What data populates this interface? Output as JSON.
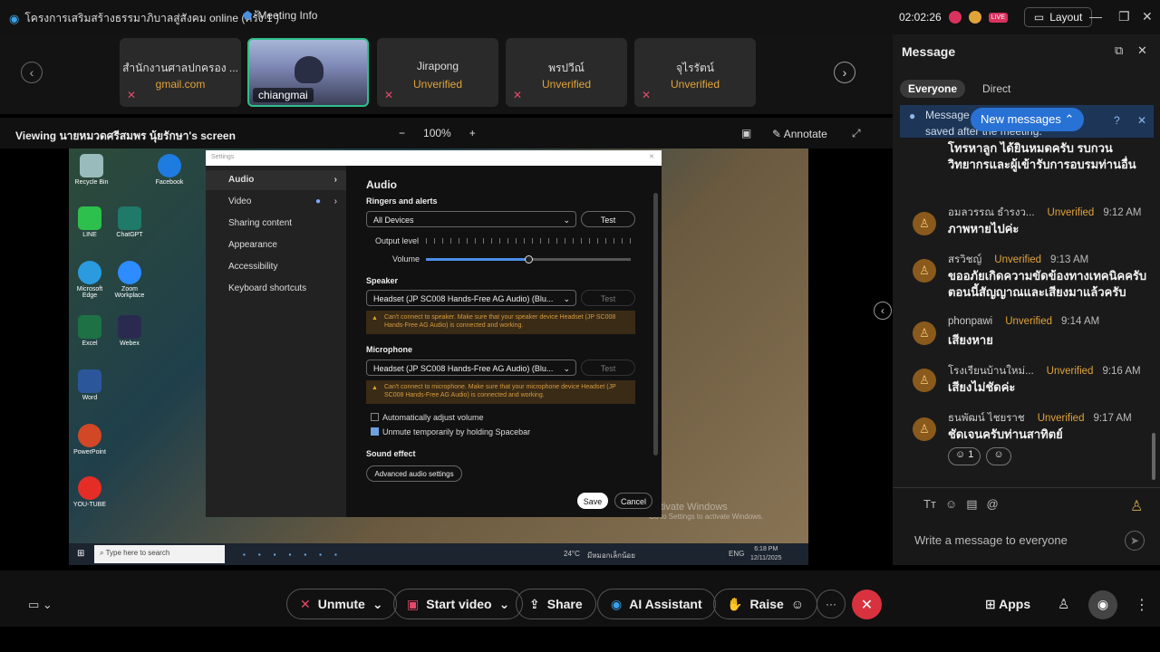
{
  "topbar": {
    "title": "โครงการเสริมสร้างธรรมาภิบาลสู่สังคม online (ครั้ง 1 )",
    "meeting_info": "Meeting Info",
    "timer": "02:02:26",
    "layout_label": "Layout",
    "badge_live": "LIVE"
  },
  "thumbnails": [
    {
      "name": "สำนักงานศาลปกครอง ...",
      "sub": "gmail.com"
    },
    {
      "name": "chiangmai",
      "sub": ""
    },
    {
      "name": "Jirapong",
      "sub": "Unverified"
    },
    {
      "name": "พรปวีณ์",
      "sub": "Unverified"
    },
    {
      "name": "จุไรรัตน์",
      "sub": "Unverified"
    }
  ],
  "viewbar": {
    "label": "Viewing นายหมวดศรีสมพร นุ้ยรักษา's screen",
    "zoom": "100%",
    "annotate": "Annotate"
  },
  "settings": {
    "title": "Settings",
    "sidebar": [
      "Audio",
      "Video",
      "Sharing content",
      "Appearance",
      "Accessibility",
      "Keyboard shortcuts"
    ],
    "heading": "Audio",
    "ringers_label": "Ringers and alerts",
    "ringers_value": "All Devices",
    "test_label": "Test",
    "output_level": "Output level",
    "volume": "Volume",
    "volume_level": 0.5,
    "speaker_label": "Speaker",
    "speaker_value": "Headset (JP SC008 Hands-Free AG Audio) (Blu...",
    "speaker_warn": "Can't connect to speaker. Make sure that your speaker device Headset (JP SC008 Hands-Free AG Audio) is connected and working.",
    "mic_label": "Microphone",
    "mic_value": "Headset (JP SC008 Hands-Free AG Audio) (Blu...",
    "mic_warn": "Can't connect to microphone. Make sure that your microphone device Headset (JP SC008 Hands-Free AG Audio) is connected and working.",
    "auto_adjust": "Automatically adjust volume",
    "unmute_space": "Unmute temporarily by holding Spacebar",
    "sound_effect": "Sound effect",
    "advanced": "Advanced audio settings",
    "save": "Save",
    "cancel": "Cancel"
  },
  "desktop": {
    "icons": [
      "Recycle Bin",
      "Facebook",
      "LINE",
      "ChatGPT",
      "Microsoft Edge",
      "Zoom Workplace",
      "Excel",
      "Webex",
      "Word",
      "PowerPoint",
      "YOU-TUBE"
    ],
    "search_placeholder": "Type here to search",
    "weather": "24°C",
    "weather_text": "มีหมอกเล็กน้อย",
    "lang": "ENG",
    "clock_time": "6:18 PM",
    "clock_date": "12/11/2025",
    "watermark1": "Activate Windows",
    "watermark2": "Go to Settings to activate Windows."
  },
  "chat": {
    "title": "Message",
    "tabs": [
      "Everyone",
      "Direct"
    ],
    "banner_line1": "Message",
    "banner_line2": "saved after the meeting.",
    "new_messages": "New messages",
    "first_message": "โทรหาลูก ได้ยินหมดครับ รบกวนวิทยากรและผู้เข้ารับการอบรมท่านอื่น",
    "messages": [
      {
        "name": "อมลวรรณ ธำรงว...",
        "status": "Unverified",
        "time": "9:12 AM",
        "text": "ภาพหายไปค่ะ"
      },
      {
        "name": "สรวิชญ์",
        "status": "Unverified",
        "time": "9:13 AM",
        "text": "ขออภัยเกิดความขัดข้องทางเทคนิคครับ ตอนนี้สัญญาณและเสียงมาแล้วครับ"
      },
      {
        "name": "phonpawi",
        "status": "Unverified",
        "time": "9:14 AM",
        "text": "เสียงหาย"
      },
      {
        "name": "โรงเรียนบ้านใหม่...",
        "status": "Unverified",
        "time": "9:16 AM",
        "text": "เสียงไม่ชัดค่ะ"
      },
      {
        "name": "ธนพัฒน์ ไชยราช",
        "status": "Unverified",
        "time": "9:17 AM",
        "text": "ชัดเจนครับท่านสาทิตย์"
      }
    ],
    "reaction_count": "1",
    "composer_placeholder": "Write a message to everyone"
  },
  "bottombar": {
    "unmute": "Unmute",
    "start_video": "Start video",
    "share": "Share",
    "ai_assistant": "AI Assistant",
    "raise": "Raise",
    "more": "···",
    "apps": "Apps"
  }
}
